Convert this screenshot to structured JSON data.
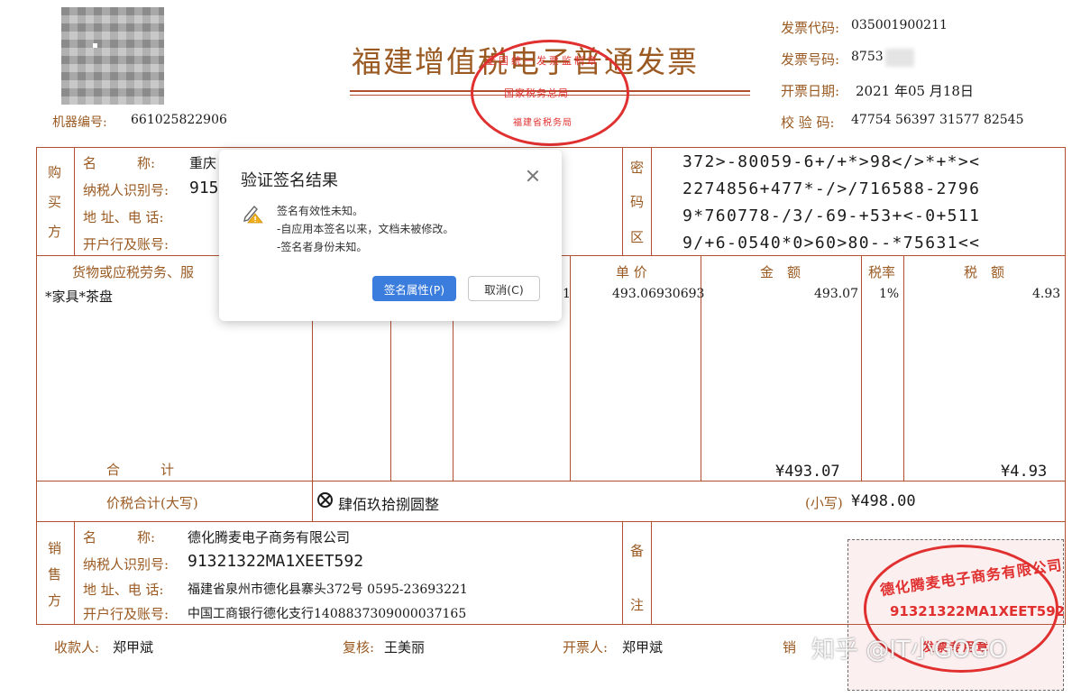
{
  "invoice": {
    "title": "福建增值税电子普通发票",
    "machine_no_label": "机器编号:",
    "machine_no": "661025822906",
    "code_label": "发票代码:",
    "code": "035001900211",
    "number_label": "发票号码:",
    "number": "8753",
    "date_label": "开票日期:",
    "date": "2021 年05 月18日",
    "check_label": "校 验 码:",
    "check_code": "47754 56397 31577 82545"
  },
  "official_stamp": {
    "line1": "全国统一发票监制章",
    "line2": "国家税务总局",
    "line3": "福建省税务局"
  },
  "buyer": {
    "section": [
      "购",
      "买",
      "方"
    ],
    "name_label": "名　　　称:",
    "name": "重庆",
    "tax_label": "纳税人识别号:",
    "tax_id": "915",
    "addr_label": "地 址、电 话:",
    "bank_label": "开户行及账号:"
  },
  "cipher": {
    "section": [
      "密",
      "码",
      "区"
    ],
    "lines": [
      "372>-80059-6+/+*>98</>*+*><",
      "2274856+477*-/>/716588-2796",
      "9*760778-/3/-69-+53+<-0+511",
      "9/+6-0540*0>60>80--*75631<<"
    ]
  },
  "items": {
    "col_goods": "货物或应税劳务、服",
    "col_price": "单 价",
    "col_amount": "金　额",
    "col_rate": "税率",
    "col_tax": "税　额",
    "row_name": "*家具*茶盘",
    "row_qty": "1",
    "row_price": "493.06930693",
    "row_amount": "493.07",
    "row_rate": "1%",
    "row_tax": "4.93",
    "total_label": "合　　　计",
    "total_amount": "¥493.07",
    "total_tax": "¥4.93"
  },
  "grand": {
    "label": "价税合计(大写)",
    "words": "肆佰玖拾捌圆整",
    "small_label": "(小写)",
    "small_value": "¥498.00"
  },
  "seller": {
    "section": [
      "销",
      "售",
      "方"
    ],
    "name_label": "名　　　称:",
    "name": "德化腾麦电子商务有限公司",
    "tax_label": "纳税人识别号:",
    "tax_id": "91321322MA1XEET592",
    "addr_label": "地 址、电 话:",
    "addr": "福建省泉州市德化县寨头372号 0595-23693221",
    "bank_label": "开户行及账号:",
    "bank": "中国工商银行德化支行1408837309000037165"
  },
  "remarks": {
    "section": [
      "备",
      "注"
    ]
  },
  "seller_stamp": {
    "company": "德化腾麦电子商务有限公司",
    "tax_id": "91321322MA1XEET592",
    "label": "发票专用章"
  },
  "footer": {
    "payee_label": "收款人:",
    "payee": "郑甲斌",
    "review_label": "复核:",
    "review": "王美丽",
    "issuer_label": "开票人:",
    "issuer": "郑甲斌",
    "seller_label": "销"
  },
  "watermark": "知乎 @IT小GOGO",
  "dialog": {
    "title": "验证签名结果",
    "line1": "签名有效性未知。",
    "line2": "-自应用本签名以来，文档未被修改。",
    "line3": "-签名者身份未知。",
    "primary_btn": "签名属性(P)",
    "cancel_btn": "取消(C)"
  },
  "colors": {
    "invoice_brown": "#9a5a22",
    "stamp_red": "#e03030",
    "primary_blue": "#3b7ddd"
  }
}
